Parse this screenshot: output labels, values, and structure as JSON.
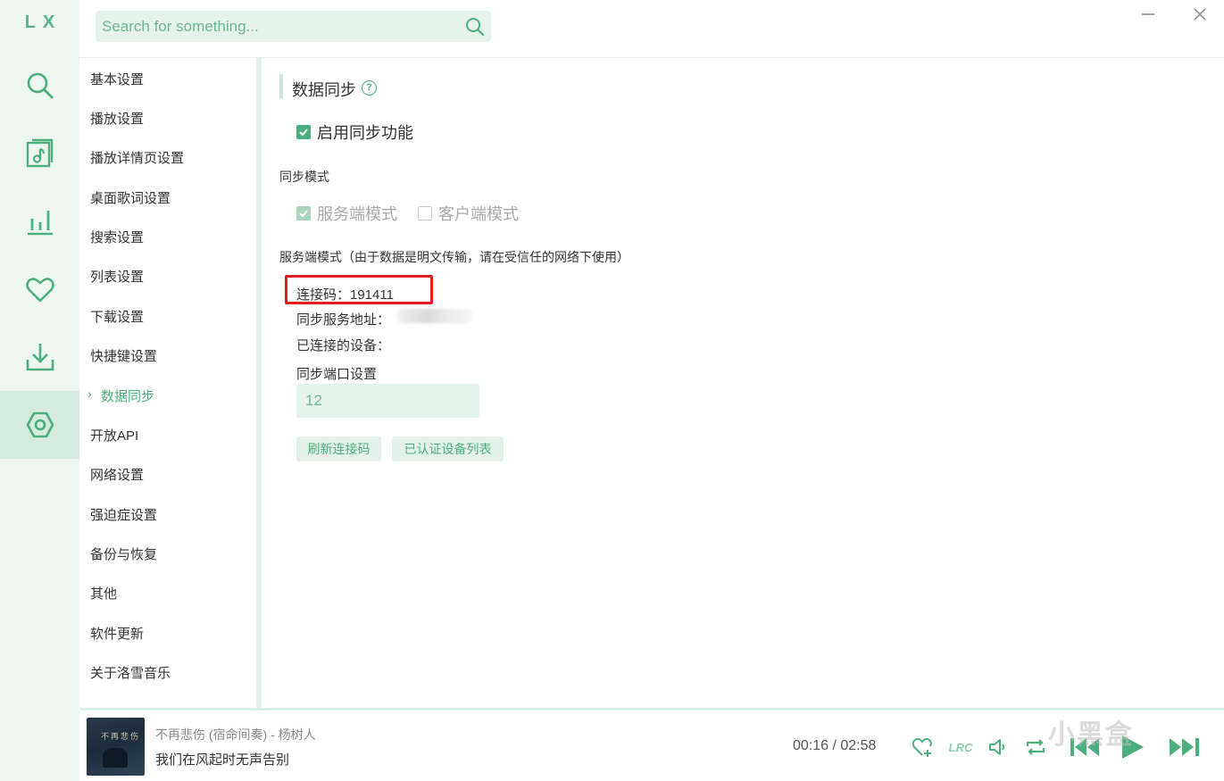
{
  "app": {
    "logo": "LX"
  },
  "search": {
    "placeholder": "Search for something..."
  },
  "rail": {
    "items": [
      {
        "icon": "search-icon",
        "active": false
      },
      {
        "icon": "music-list-icon",
        "active": false
      },
      {
        "icon": "chart-icon",
        "active": false
      },
      {
        "icon": "heart-icon",
        "active": false
      },
      {
        "icon": "download-icon",
        "active": false
      },
      {
        "icon": "settings-icon",
        "active": true
      }
    ]
  },
  "nav": {
    "items": [
      {
        "label": "基本设置"
      },
      {
        "label": "播放设置"
      },
      {
        "label": "播放详情页设置"
      },
      {
        "label": "桌面歌词设置"
      },
      {
        "label": "搜索设置"
      },
      {
        "label": "列表设置"
      },
      {
        "label": "下载设置"
      },
      {
        "label": "快捷键设置"
      },
      {
        "label": "数据同步",
        "active": true
      },
      {
        "label": "开放API"
      },
      {
        "label": "网络设置"
      },
      {
        "label": "强迫症设置"
      },
      {
        "label": "备份与恢复"
      },
      {
        "label": "其他"
      },
      {
        "label": "软件更新"
      },
      {
        "label": "关于洛雪音乐"
      }
    ]
  },
  "section": {
    "title": "数据同步",
    "help": "?",
    "enable_sync": {
      "label": "启用同步功能",
      "checked": true
    },
    "mode_label": "同步模式",
    "modes": [
      {
        "label": "服务端模式",
        "checked": true,
        "disabled": true
      },
      {
        "label": "客户端模式",
        "checked": false,
        "disabled": true
      }
    ],
    "server_note": "服务端模式（由于数据是明文传输，请在受信任的网络下使用）",
    "connect_code": "连接码：191411",
    "server_address_label": "同步服务地址：",
    "connected_devices_label": "已连接的设备：",
    "port_label": "同步端口设置",
    "port_value": "12",
    "refresh_button": "刷新连接码",
    "devices_button": "已认证设备列表"
  },
  "player": {
    "cover_text": "不再悲伤",
    "song": "不再悲伤 (宿命间奏) - 杨树人",
    "lyric": "我们在风起时无声告别",
    "time": "00:16 / 02:58",
    "lrc_label": "LRC",
    "watermark": "小黑盒"
  },
  "colors": {
    "accent": "#4caf7e",
    "rail_bg": "#eef6f1",
    "highlight": "#e01f1f"
  }
}
